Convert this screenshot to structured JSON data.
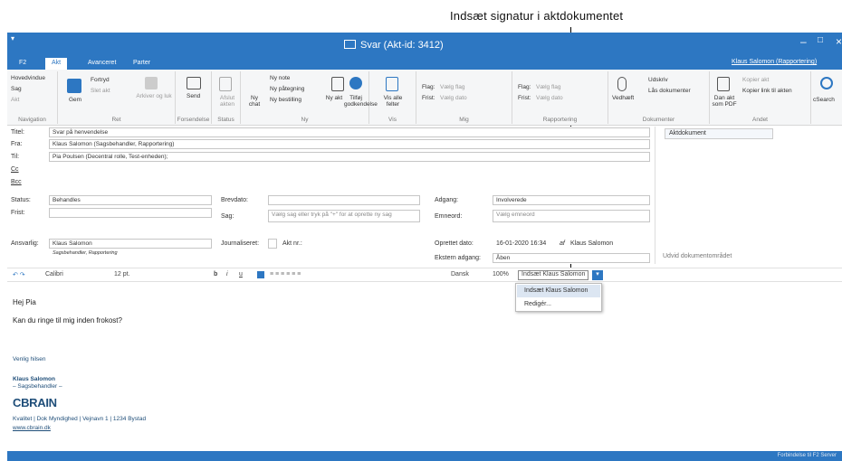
{
  "callout": {
    "text": "Indsæt signatur i aktdokumentet"
  },
  "window": {
    "title": "Svar (Akt-id: 3412)",
    "user": "Klaus Salomon (Rapportering)"
  },
  "tabs": [
    "F2",
    "Akt",
    "Avanceret",
    "Parter"
  ],
  "ribbon": {
    "groups": [
      "Navigation",
      "Ret",
      "Forsendelse",
      "Status",
      "Ny",
      "Vis",
      "Mig",
      "Rapportering",
      "Dokumenter",
      "Andet"
    ],
    "nav": [
      "Hovedvindue",
      "Sag",
      "Akt"
    ],
    "ret": {
      "gem": "Gem",
      "fortryd": "Fortryd",
      "slet": "Slet akt",
      "arkiver": "Arkiver og luk"
    },
    "send": "Send",
    "afslut": "Afslut akten",
    "ny": {
      "chat": "Ny chat",
      "note": "Ny note",
      "paategning": "Ny påtegning",
      "bestilling": "Ny bestilling",
      "akt": "Ny akt",
      "tilfoej": "Tilføj godkendelse"
    },
    "vis": "Vis alle felter",
    "mig": {
      "flag": "Flag:",
      "flagv": "Vælg flag",
      "frist": "Frist:",
      "fristv": "Vælg dato"
    },
    "rap": {
      "flag": "Flag:",
      "flagv": "Vælg flag",
      "frist": "Frist:",
      "fristv": "Vælg dato"
    },
    "dok": {
      "vedhaeft": "Vedhæft",
      "udskriv": "Udskriv",
      "laas": "Lås dokumenter"
    },
    "andet": {
      "danakt": "Dan akt som PDF",
      "kopierakt": "Kopier akt",
      "kopierlink": "Kopier link til akten",
      "csearch": "cSearch"
    }
  },
  "form": {
    "titel_label": "Titel:",
    "titel": "Svar på henvendelse",
    "fra_label": "Fra:",
    "fra": "Klaus Salomon (Sagsbehandler, Rapportering)",
    "til_label": "Til:",
    "til": "Pia Poulsen (Decentral rolle, Test-enheden);",
    "cc_label": "Cc",
    "bcc_label": "Bcc",
    "status_label": "Status:",
    "status": "Behandles",
    "frist_label": "Frist:",
    "brevdato_label": "Brevdato:",
    "sag_label": "Sag:",
    "sag_ph": "Vælg sag eller tryk på \"+\" for at oprette ny sag",
    "adgang_label": "Adgang:",
    "adgang": "Involverede",
    "emneord_label": "Emneord:",
    "emneord_ph": "Vælg emneord",
    "ansvarlig_label": "Ansvarlig:",
    "ansvarlig": "Klaus Salomon",
    "ansvarlig_sub": "Sagsbehandler, Rapportering",
    "journal_label": "Journaliseret:",
    "aktnr": "Akt nr.:",
    "oprettet_label": "Oprettet dato:",
    "oprettet": "16-01-2020 16:34",
    "af": "af",
    "oprettet_af": "Klaus Salomon",
    "ekstern_label": "Ekstern adgang:",
    "ekstern": "Åben"
  },
  "side": {
    "aktdokument": "Aktdokument",
    "udvid": "Udvid dokumentområdet"
  },
  "format": {
    "font": "Calibri",
    "size": "12 pt.",
    "lang": "Dansk",
    "zoom": "100%",
    "signature": "Indsæt Klaus Salomon"
  },
  "dropdown": [
    "Indsæt Klaus Salomon",
    "Redigér..."
  ],
  "body": {
    "greet": "Hej Pia",
    "line": "Kan du ringe til mig inden frokost?",
    "closing": "Venlig hilsen",
    "name": "Klaus Salomon",
    "role": "– Sagsbehandler –",
    "logo": "CBRAIN",
    "address": "Kvalitet  |  Dok Myndighed  |  Vejnavn 1  |  1234 Bystad",
    "web": "www.cbrain.dk"
  },
  "statusbar": {
    "right": "Forbindelse til F2 Server"
  },
  "colors": {
    "accent": "#2d77c2",
    "highlight": "#dce6f2"
  }
}
